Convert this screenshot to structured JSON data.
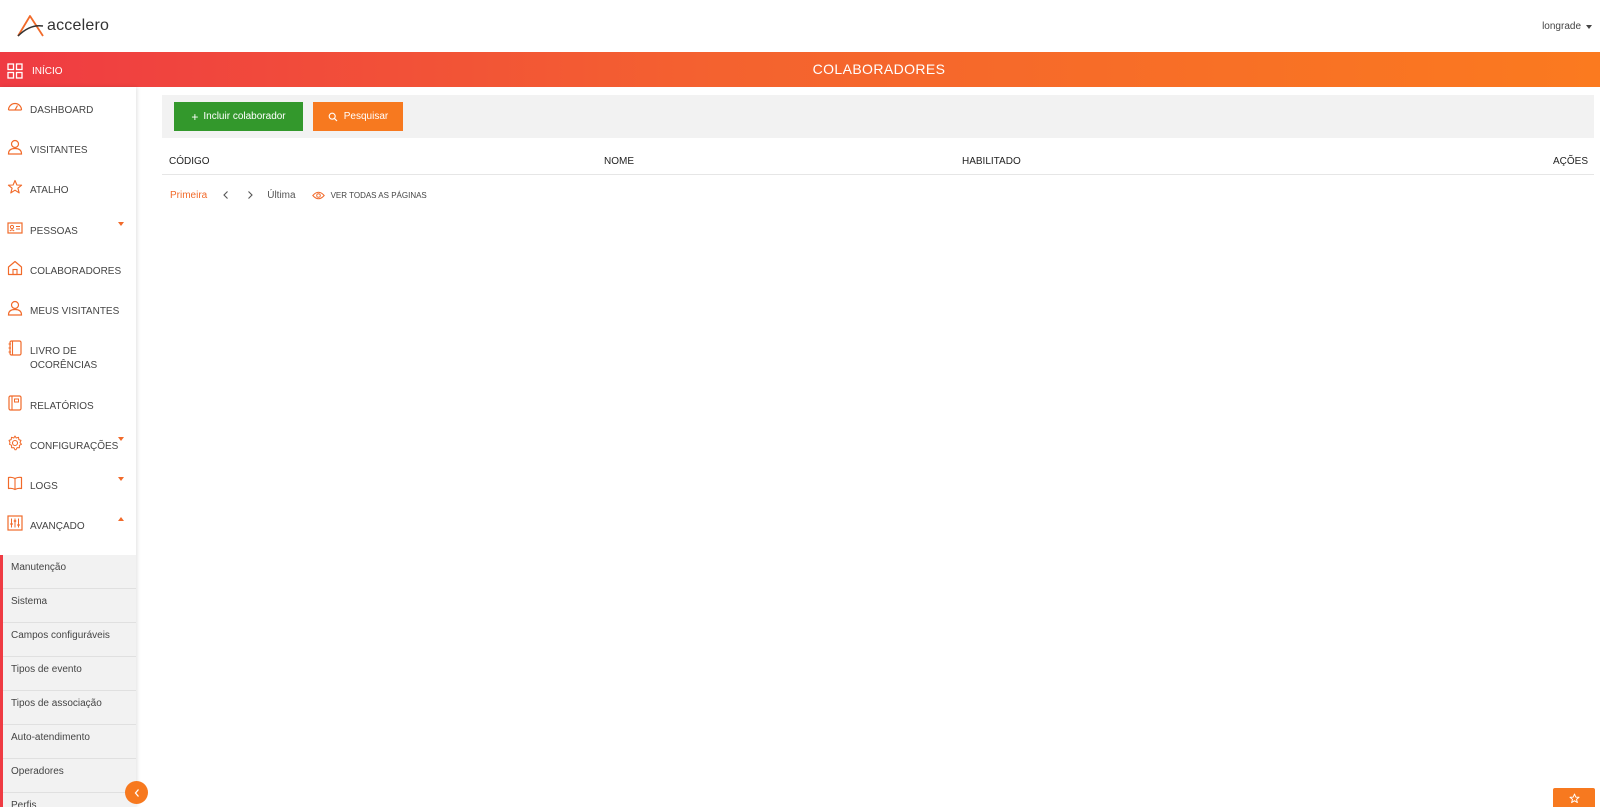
{
  "header": {
    "app_name": "accelero",
    "user": "longrade"
  },
  "band": {
    "home_label": "INÍCIO",
    "title": "COLABORADORES"
  },
  "sidebar": {
    "items": [
      {
        "label": "DASHBOARD",
        "icon": "dashboard-icon"
      },
      {
        "label": "VISITANTES",
        "icon": "user-icon"
      },
      {
        "label": "ATALHO",
        "icon": "star-icon"
      },
      {
        "label": "PESSOAS",
        "icon": "id-card-icon",
        "expandable": true
      },
      {
        "label": "COLABORADORES",
        "icon": "home-icon"
      },
      {
        "label": "MEUS VISITANTES",
        "icon": "user-icon"
      },
      {
        "label": "LIVRO DE OCORÊNCIAS",
        "icon": "book-icon"
      },
      {
        "label": "RELATÓRIOS",
        "icon": "report-icon"
      },
      {
        "label": "CONFIGURAÇÕES",
        "icon": "gear-icon",
        "expandable": true
      },
      {
        "label": "LOGS",
        "icon": "open-book-icon",
        "expandable": true
      },
      {
        "label": "AVANÇADO",
        "icon": "sliders-icon",
        "expanded": true
      }
    ],
    "sub_items": [
      "Manutenção",
      "Sistema",
      "Campos configuráveis",
      "Tipos de evento",
      "Tipos de associação",
      "Auto-atendimento",
      "Operadores",
      "Perfis"
    ]
  },
  "toolbar": {
    "add_label": "Incluir colaborador",
    "search_label": "Pesquisar"
  },
  "table": {
    "columns": [
      "CÓDIGO",
      "NOME",
      "HABILITADO",
      "AÇÕES"
    ]
  },
  "pager": {
    "first": "Primeira",
    "last": "Última",
    "view_all": "VER TODAS AS PÁGINAS"
  },
  "colors": {
    "accent_orange": "#f7791f",
    "accent_red": "#ef3b43",
    "add_green": "#33982c"
  }
}
